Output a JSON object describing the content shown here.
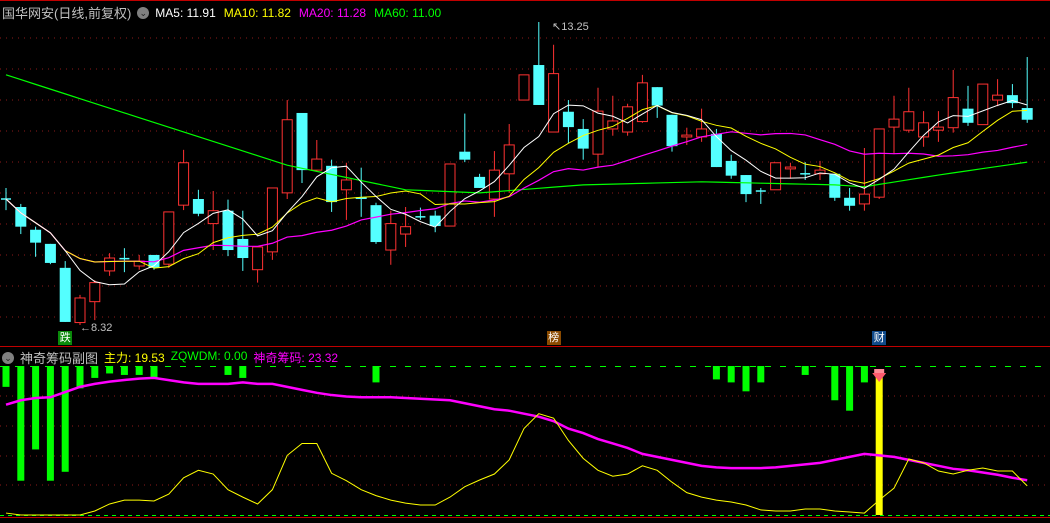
{
  "main": {
    "title": "国华网安(日线,前复权)",
    "ma_labels": [
      {
        "label": "MA5: 11.91",
        "color": "#ffffff"
      },
      {
        "label": "MA10: 11.82",
        "color": "#ffff00"
      },
      {
        "label": "MA20: 11.28",
        "color": "#ff00ff"
      },
      {
        "label": "MA60: 11.00",
        "color": "#00ff00"
      }
    ],
    "high_label": "13.25",
    "low_label": "8.32",
    "markers": [
      {
        "text": "跌",
        "index": 4,
        "color": "#0a8a0a"
      },
      {
        "text": "榜",
        "index": 37,
        "color": "#8a4a00"
      },
      {
        "text": "财",
        "index": 59,
        "color": "#104a8a"
      }
    ]
  },
  "sub": {
    "title": "神奇筹码副图",
    "labels": [
      {
        "label": "主力: 19.53",
        "color": "#ffff00"
      },
      {
        "label": "ZQWDM: 0.00",
        "color": "#00ff00"
      },
      {
        "label": "神奇筹码: 23.32",
        "color": "#ff00ff"
      }
    ]
  },
  "colors": {
    "up": "#ff3232",
    "down": "#54ffff",
    "ma5": "#ffffff",
    "ma10": "#ffff00",
    "ma20": "#ff00ff",
    "ma60": "#00ff00",
    "grid": "#8b1a1a"
  },
  "chart_data": {
    "type": "candlestick",
    "price_range": [
      8.32,
      13.25
    ],
    "candles": [
      [
        10.37,
        10.37,
        10.55,
        10.19
      ],
      [
        10.24,
        9.92,
        10.29,
        9.8
      ],
      [
        9.87,
        9.66,
        9.92,
        9.43
      ],
      [
        9.64,
        9.33,
        9.64,
        9.31
      ],
      [
        9.25,
        8.37,
        9.36,
        8.37
      ],
      [
        8.36,
        8.76,
        8.81,
        8.32
      ],
      [
        8.7,
        9.01,
        9.05,
        8.4
      ],
      [
        9.2,
        9.41,
        9.49,
        9.12
      ],
      [
        9.4,
        9.39,
        9.57,
        9.18
      ],
      [
        9.28,
        9.36,
        9.46,
        9.22
      ],
      [
        9.46,
        9.25,
        9.46,
        9.22
      ],
      [
        9.31,
        10.16,
        10.16,
        9.25
      ],
      [
        10.27,
        10.96,
        11.17,
        10.19
      ],
      [
        10.37,
        10.13,
        10.52,
        10.09
      ],
      [
        9.97,
        10.18,
        10.5,
        9.54
      ],
      [
        10.18,
        9.54,
        10.36,
        9.44
      ],
      [
        9.72,
        9.41,
        10.18,
        9.2
      ],
      [
        9.22,
        9.59,
        9.59,
        9.01
      ],
      [
        9.51,
        10.55,
        10.55,
        9.38
      ],
      [
        10.47,
        11.66,
        11.98,
        10.37
      ],
      [
        11.77,
        10.84,
        11.77,
        10.63
      ],
      [
        10.84,
        11.02,
        11.33,
        10.81
      ],
      [
        10.91,
        10.32,
        11.01,
        10.16
      ],
      [
        10.52,
        10.68,
        10.96,
        10.03
      ],
      [
        10.4,
        10.37,
        10.88,
        10.08
      ],
      [
        10.27,
        9.67,
        10.31,
        9.64
      ],
      [
        9.54,
        9.97,
        10.18,
        9.3
      ],
      [
        9.8,
        9.92,
        10.24,
        9.59
      ],
      [
        10.08,
        10.08,
        10.23,
        10.03
      ],
      [
        10.1,
        9.93,
        10.18,
        9.83
      ],
      [
        9.93,
        10.94,
        10.94,
        9.93
      ],
      [
        11.14,
        11.01,
        11.76,
        10.97
      ],
      [
        10.73,
        10.55,
        10.78,
        10.55
      ],
      [
        10.37,
        10.84,
        11.15,
        10.08
      ],
      [
        10.78,
        11.25,
        11.59,
        10.47
      ],
      [
        11.98,
        12.39,
        12.39,
        11.98
      ],
      [
        12.55,
        11.9,
        13.25,
        11.9
      ],
      [
        11.46,
        12.41,
        12.88,
        11.46
      ],
      [
        11.79,
        11.54,
        11.98,
        11.28
      ],
      [
        11.51,
        11.19,
        11.67,
        11.01
      ],
      [
        11.1,
        11.8,
        12.18,
        10.88
      ],
      [
        11.51,
        11.64,
        12.05,
        11.4
      ],
      [
        11.46,
        11.87,
        11.92,
        11.4
      ],
      [
        11.63,
        12.26,
        12.39,
        11.61
      ],
      [
        12.19,
        11.89,
        12.19,
        11.69
      ],
      [
        11.74,
        11.23,
        11.74,
        11.14
      ],
      [
        11.38,
        11.41,
        11.53,
        11.25
      ],
      [
        11.38,
        11.51,
        11.84,
        11.3
      ],
      [
        11.43,
        10.89,
        11.51,
        10.89
      ],
      [
        10.99,
        10.75,
        11.09,
        10.7
      ],
      [
        10.76,
        10.45,
        10.76,
        10.32
      ],
      [
        10.5,
        10.5,
        10.55,
        10.29
      ],
      [
        10.52,
        10.96,
        10.96,
        10.52
      ],
      [
        10.86,
        10.89,
        10.96,
        10.7
      ],
      [
        10.78,
        10.78,
        10.97,
        10.68
      ],
      [
        10.78,
        10.84,
        10.99,
        10.68
      ],
      [
        10.78,
        10.39,
        10.78,
        10.34
      ],
      [
        10.39,
        10.26,
        10.55,
        10.18
      ],
      [
        10.29,
        10.45,
        11.2,
        10.18
      ],
      [
        10.4,
        11.51,
        11.51,
        10.37
      ],
      [
        11.54,
        11.67,
        12.05,
        11.1
      ],
      [
        11.49,
        11.79,
        12.18,
        11.45
      ],
      [
        11.38,
        11.61,
        11.8,
        11.22
      ],
      [
        11.49,
        11.54,
        11.8,
        11.3
      ],
      [
        11.53,
        12.02,
        12.47,
        11.45
      ],
      [
        11.84,
        11.61,
        12.21,
        11.56
      ],
      [
        11.58,
        12.24,
        12.24,
        11.58
      ],
      [
        11.98,
        12.06,
        12.32,
        11.88
      ],
      [
        12.06,
        11.93,
        12.24,
        11.85
      ],
      [
        11.85,
        11.66,
        12.68,
        11.61
      ]
    ],
    "ma60_anchors": [
      [
        0,
        12.39
      ],
      [
        19,
        10.92
      ],
      [
        27,
        10.52
      ],
      [
        32,
        10.47
      ],
      [
        39,
        10.6
      ],
      [
        47,
        10.65
      ],
      [
        56,
        10.6
      ],
      [
        58,
        10.57
      ],
      [
        63,
        10.76
      ],
      [
        69,
        10.97
      ]
    ],
    "sub_range": [
      0,
      100
    ],
    "zhuli": [
      1.3,
      0,
      0,
      0,
      0,
      0,
      2.7,
      7.4,
      10,
      10,
      9.4,
      14,
      25,
      30,
      27.5,
      17,
      12,
      7.4,
      17,
      40,
      48,
      48,
      28,
      23,
      17,
      13,
      10,
      8,
      6.7,
      6.7,
      12,
      19,
      23.5,
      27.5,
      37,
      58,
      68,
      65,
      50,
      38,
      30,
      26,
      27.5,
      33,
      30,
      22,
      15,
      12,
      10,
      8.7,
      6.7,
      3.4,
      2.7,
      2.7,
      4,
      4,
      2.7,
      2,
      1.3,
      10,
      18,
      37.6,
      35,
      29.5,
      27.5,
      30,
      31.5,
      29.5,
      29.5,
      19.53
    ],
    "shenqi_chouma": [
      74,
      77,
      78.5,
      79,
      82.5,
      86,
      88,
      89.5,
      90.6,
      91.5,
      92,
      90.5,
      89,
      88,
      88,
      88,
      89,
      88,
      88,
      86,
      84,
      82,
      80.5,
      79.5,
      79,
      79,
      79,
      78.5,
      78,
      77.5,
      77,
      75,
      73,
      71,
      70,
      68,
      66,
      63,
      58,
      55,
      51,
      48,
      45,
      41,
      39,
      37,
      35,
      33,
      32,
      31.5,
      31.5,
      31.5,
      32,
      33,
      34,
      35,
      37,
      39,
      41,
      40,
      39,
      37,
      35,
      33,
      31,
      30,
      28.5,
      27,
      25,
      23.32
    ],
    "zqwdm_bars": [
      [
        0,
        14
      ],
      [
        1,
        77
      ],
      [
        2,
        56
      ],
      [
        3,
        77
      ],
      [
        4,
        71
      ],
      [
        5,
        15
      ],
      [
        6,
        8
      ],
      [
        7,
        5
      ],
      [
        8,
        6
      ],
      [
        9,
        6
      ],
      [
        10,
        8
      ],
      [
        15,
        6
      ],
      [
        16,
        8
      ],
      [
        25,
        11
      ],
      [
        48,
        9
      ],
      [
        49,
        11
      ],
      [
        50,
        17
      ],
      [
        51,
        11
      ],
      [
        54,
        6
      ],
      [
        56,
        23
      ],
      [
        57,
        30
      ],
      [
        58,
        11
      ]
    ],
    "signal_index": 59
  }
}
